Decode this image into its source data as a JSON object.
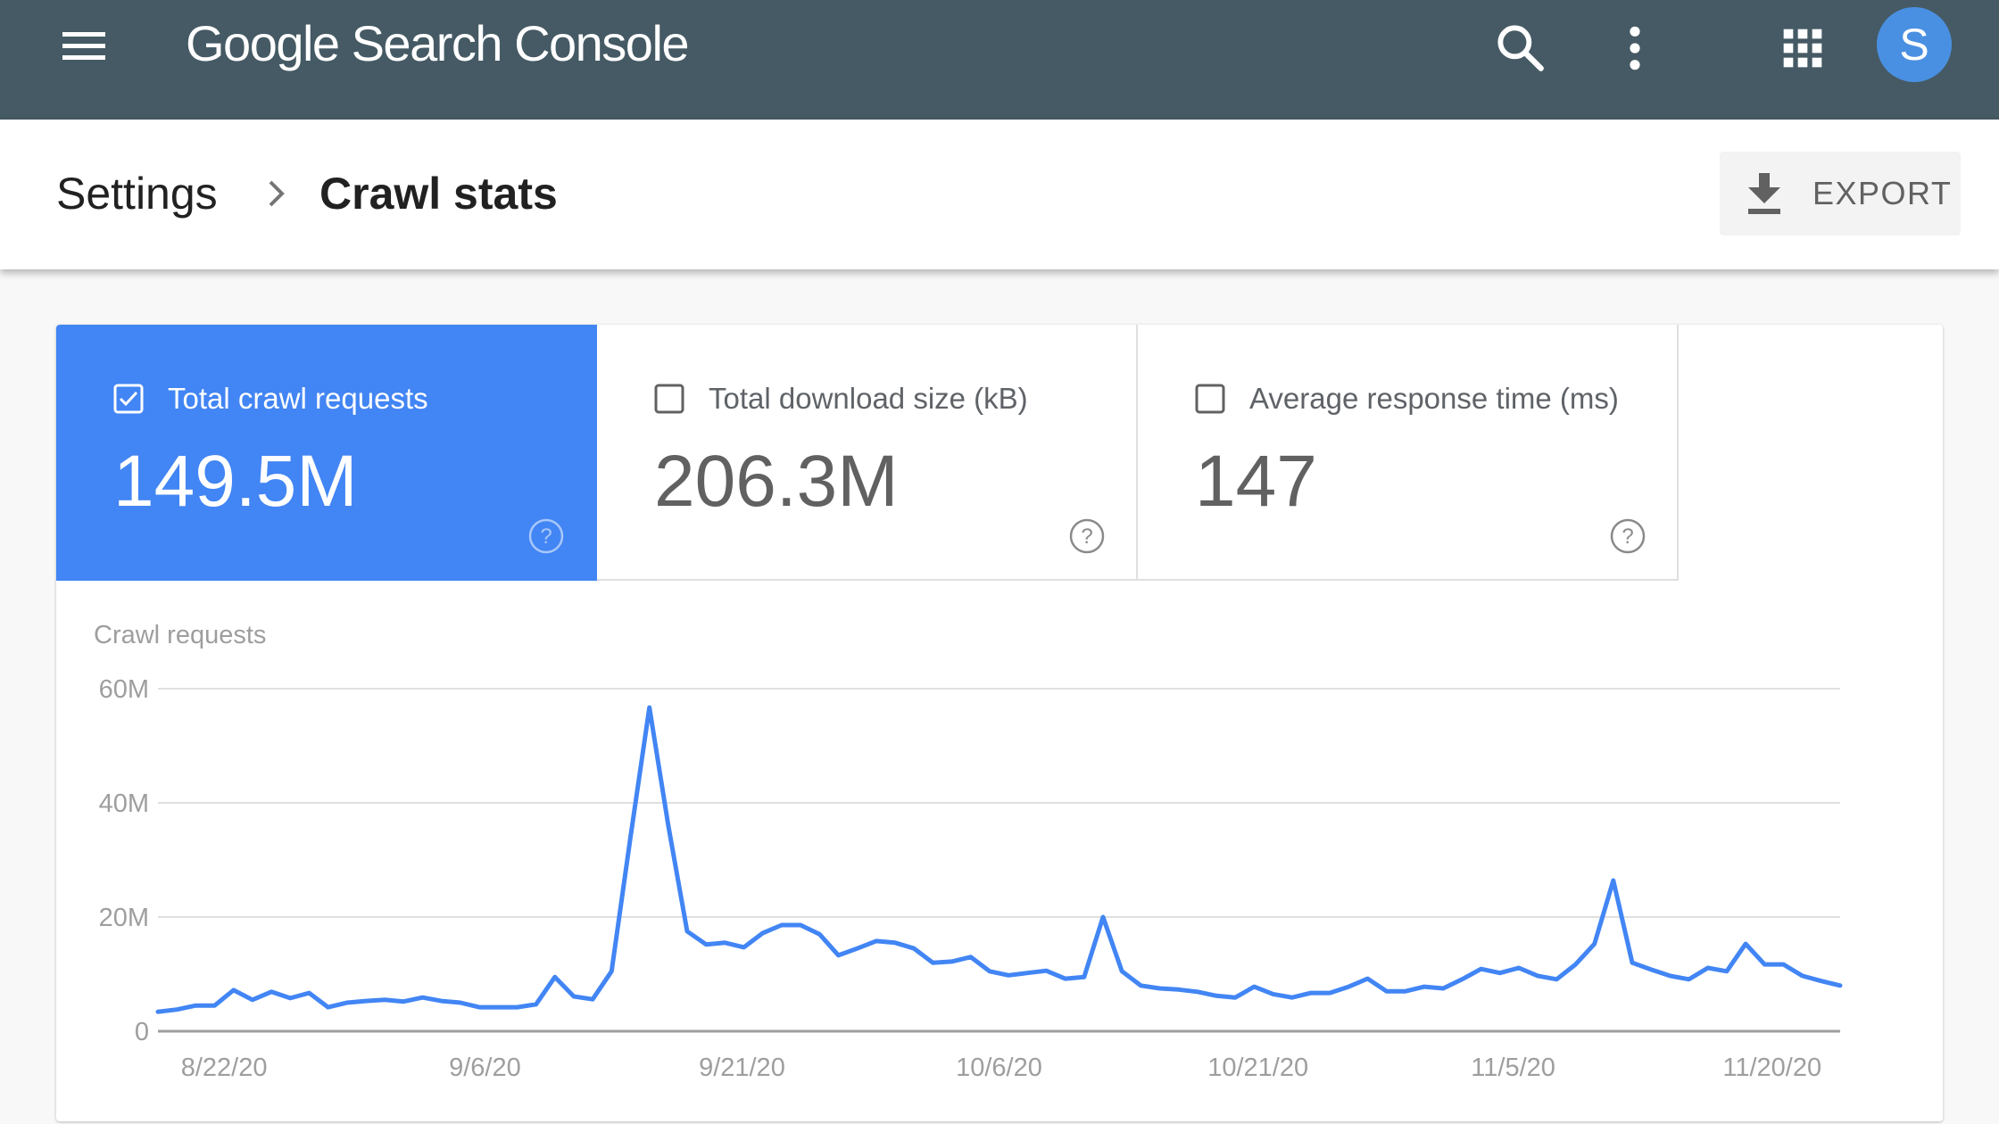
{
  "app": {
    "title_brand": "Google",
    "title_product": "Search Console",
    "avatar_initial": "S",
    "colors": {
      "header_bg": "#455a64",
      "accent_blue": "#4285f4",
      "avatar_bg": "#4a90e2",
      "line": "#4285f4"
    },
    "icons": {
      "menu": "hamburger-menu-icon",
      "search": "search-icon",
      "more": "more-vert-icon",
      "apps": "apps-grid-icon"
    }
  },
  "breadcrumb": {
    "parent": "Settings",
    "separator_icon": "chevron-right-icon",
    "current": "Crawl stats"
  },
  "toolbar": {
    "export_label": "EXPORT",
    "export_icon": "download-icon"
  },
  "metrics": [
    {
      "label": "Total crawl requests",
      "value": "149.5M",
      "checked": true
    },
    {
      "label": "Total download size (kB)",
      "value": "206.3M",
      "checked": false
    },
    {
      "label": "Average response time (ms)",
      "value": "147",
      "checked": false
    }
  ],
  "chart_data": {
    "type": "line",
    "title": "Crawl requests",
    "xlabel": "",
    "ylabel": "",
    "ylim": [
      0,
      60000000
    ],
    "y_ticks": [
      {
        "value": 0,
        "label": "0"
      },
      {
        "value": 20000000,
        "label": "20M"
      },
      {
        "value": 40000000,
        "label": "40M"
      },
      {
        "value": 60000000,
        "label": "60M"
      }
    ],
    "grid": true,
    "legend": "none",
    "x_ticks": [
      {
        "index": 3.5,
        "label": "8/22/20"
      },
      {
        "index": 17.3,
        "label": "9/6/20"
      },
      {
        "index": 30.9,
        "label": "9/21/20"
      },
      {
        "index": 44.5,
        "label": "10/6/20"
      },
      {
        "index": 58.2,
        "label": "10/21/20"
      },
      {
        "index": 71.7,
        "label": "11/5/20"
      },
      {
        "index": 85.4,
        "label": "11/20/20"
      }
    ],
    "series": [
      {
        "name": "Total crawl requests",
        "unit": "M",
        "values": [
          3.4,
          3.8,
          4.5,
          4.5,
          7.2,
          5.5,
          6.9,
          5.8,
          6.7,
          4.2,
          5.0,
          5.3,
          5.5,
          5.2,
          5.9,
          5.3,
          5.0,
          4.2,
          4.2,
          4.2,
          4.7,
          9.5,
          6.1,
          5.6,
          10.5,
          34.0,
          56.7,
          36.0,
          17.5,
          15.2,
          15.5,
          14.7,
          17.2,
          18.6,
          18.6,
          17.0,
          13.3,
          14.5,
          15.8,
          15.5,
          14.5,
          12.0,
          12.2,
          13.0,
          10.5,
          9.8,
          10.2,
          10.6,
          9.2,
          9.5,
          20.0,
          10.5,
          8.0,
          7.5,
          7.3,
          6.9,
          6.2,
          5.9,
          7.8,
          6.5,
          5.9,
          6.7,
          6.7,
          7.8,
          9.2,
          7.0,
          7.0,
          7.8,
          7.5,
          9.1,
          10.9,
          10.2,
          11.1,
          9.7,
          9.1,
          11.7,
          15.3,
          26.4,
          12.0,
          10.8,
          9.7,
          9.1,
          11.1,
          10.5,
          15.3,
          11.7,
          11.7,
          9.7,
          8.8,
          8.0
        ]
      }
    ]
  }
}
